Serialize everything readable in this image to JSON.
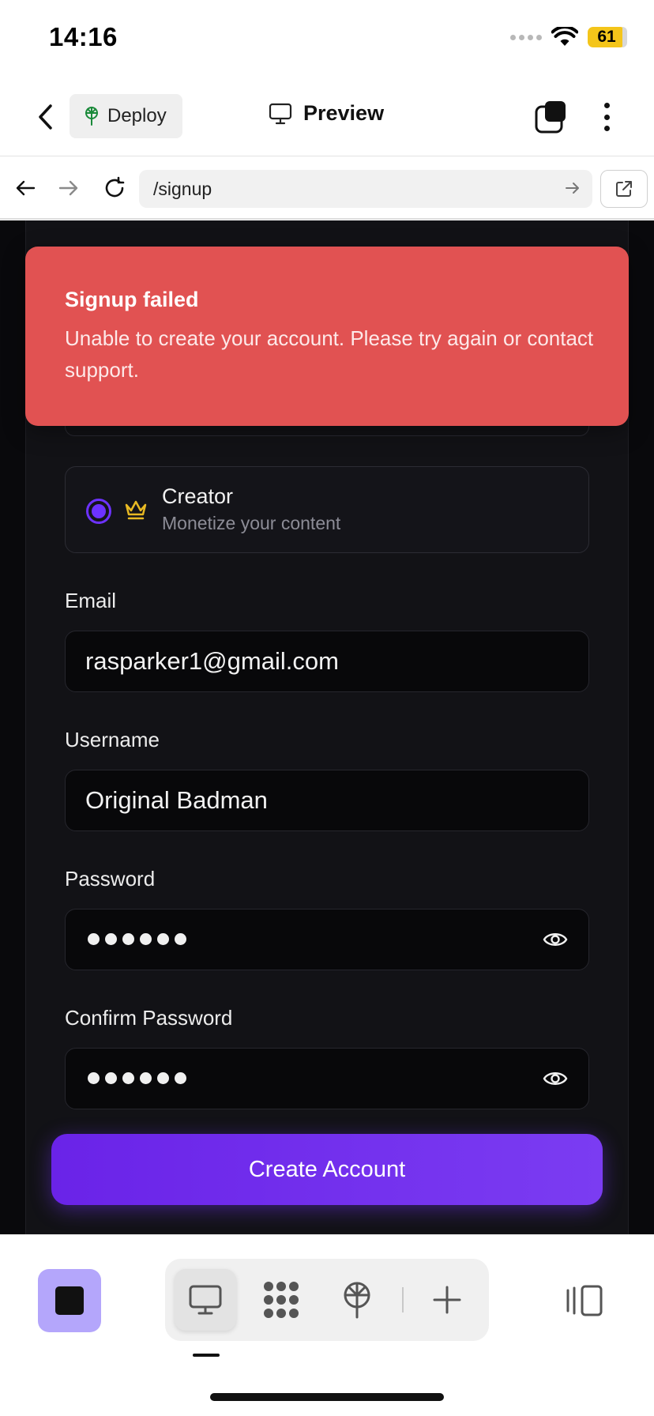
{
  "status_bar": {
    "time": "14:16",
    "battery": "61"
  },
  "header": {
    "deploy_label": "Deploy",
    "title": "Preview"
  },
  "browser": {
    "url": "/signup"
  },
  "account_type": {
    "title": "Creator",
    "description": "Monetize your content",
    "selected": true
  },
  "form": {
    "email_label": "Email",
    "email_value": "rasparker1@gmail.com",
    "username_label": "Username",
    "username_value": "Original Badman",
    "password_label": "Password",
    "confirm_label": "Confirm Password",
    "submit_label": "Create Account"
  },
  "toast": {
    "title": "Signup failed",
    "message": "Unable to create your account. Please try again or contact support."
  },
  "bottom_bar": {
    "items": [
      "monitor-icon",
      "apps-icon",
      "deploy-icon",
      "plus-icon"
    ],
    "active": "monitor-icon"
  },
  "colors": {
    "accent": "#6d32ff",
    "toast": "#e15252",
    "crown": "#e8b923"
  }
}
